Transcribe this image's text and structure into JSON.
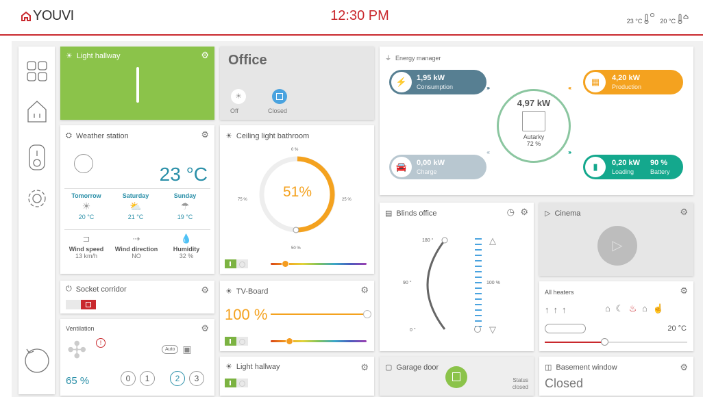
{
  "header": {
    "logo": "YOUVI",
    "time": "12:30 PM",
    "temp1": "23 °C",
    "temp2": "20 °C"
  },
  "colors": {
    "accent": "#c9282d",
    "green": "#8bc34a",
    "orange": "#f4a21f",
    "teal": "#2a8fa8"
  },
  "sidebar": {
    "items": [
      {
        "icon": "dashboard-grid-icon"
      },
      {
        "icon": "home-icon"
      },
      {
        "icon": "switch-icon"
      },
      {
        "icon": "gear-icon"
      },
      {
        "icon": "refresh-icon"
      }
    ]
  },
  "light_hallway": {
    "title": "Light hallway"
  },
  "office": {
    "title": "Office",
    "light_label": "Off",
    "blind_label": "Closed"
  },
  "weather": {
    "title": "Weather station",
    "temp": "23 °C",
    "forecast": [
      {
        "day": "Tomorrow",
        "temp": "20 °C"
      },
      {
        "day": "Saturday",
        "temp": "21 °C"
      },
      {
        "day": "Sunday",
        "temp": "19 °C"
      }
    ],
    "details": [
      {
        "label": "Wind speed",
        "value": "13 km/h"
      },
      {
        "label": "Wind direction",
        "value": "NO"
      },
      {
        "label": "Humidity",
        "value": "32 %"
      }
    ]
  },
  "ceiling": {
    "title": "Ceiling light bathroom",
    "value": "51%",
    "level": 0.51,
    "t0": "0 %",
    "t25": "25 %",
    "t50": "50 %",
    "t75": "75 %"
  },
  "energy": {
    "title": "Energy manager",
    "consumption": {
      "value": "1,95 kW",
      "label": "Consumption"
    },
    "production": {
      "value": "4,20 kW",
      "label": "Production"
    },
    "charge": {
      "value": "0,00 kW",
      "label": "Charge"
    },
    "loading": {
      "value": "0,20 kW",
      "label": "Loading",
      "value2": "90 %",
      "label2": "Battery"
    },
    "center": {
      "value": "4,97 kW",
      "label": "Autarky",
      "pct": "72 %"
    }
  },
  "blinds": {
    "title": "Blinds office",
    "a180": "180 °",
    "a90": "90 °",
    "a0": "0 °",
    "pct": "100 %"
  },
  "cinema": {
    "title": "Cinema"
  },
  "heaters": {
    "title": "All heaters",
    "temp": "20 °C"
  },
  "socket": {
    "title": "Socket corridor"
  },
  "tvboard": {
    "title": "TV-Board",
    "value": "100 %"
  },
  "ventilation": {
    "title": "Ventilation",
    "value": "65 %",
    "auto": "Auto",
    "levels": [
      "0",
      "1",
      "2",
      "3"
    ]
  },
  "light_hallway2": {
    "title": "Light hallway"
  },
  "garage": {
    "title": "Garage door",
    "status_label": "Status",
    "status_value": "closed"
  },
  "basement": {
    "title": "Basement window",
    "value": "Closed"
  }
}
